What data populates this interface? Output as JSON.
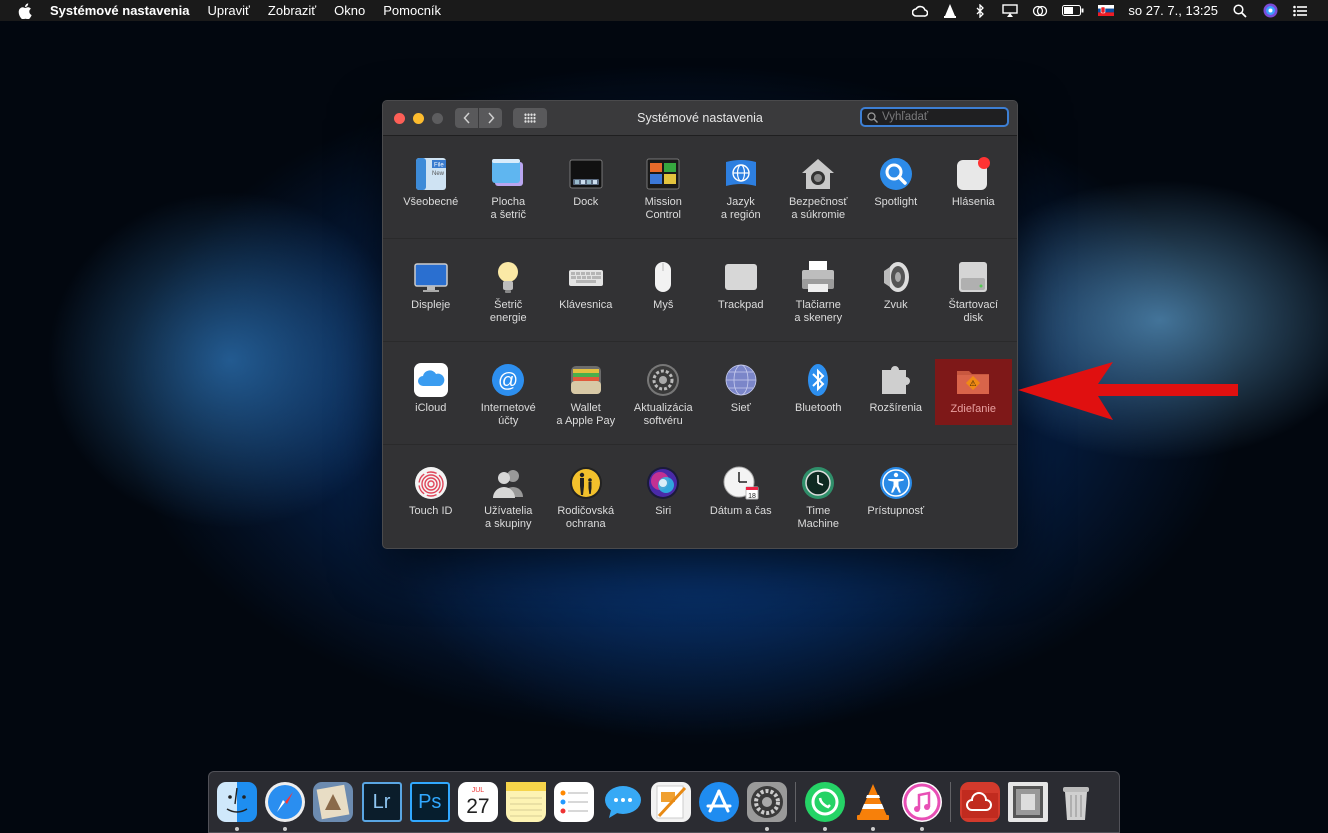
{
  "menubar": {
    "app_name": "Systémové nastavenia",
    "items": [
      "Upraviť",
      "Zobraziť",
      "Okno",
      "Pomocník"
    ],
    "clock": "so 27. 7.,  13:25",
    "status_icons": [
      "creative-cloud-icon",
      "vlc-icon",
      "bluetooth-icon",
      "airplay-icon",
      "sync-icon",
      "battery-icon",
      "slovak-flag-icon",
      "spotlight-icon",
      "siri-icon",
      "notification-center-icon"
    ]
  },
  "window": {
    "title": "Systémové nastavenia",
    "search_placeholder": "Vyhľadať",
    "rows": [
      [
        {
          "name": "general",
          "label": "Všeobecné",
          "icon": "general-icon"
        },
        {
          "name": "desktop-screensaver",
          "label": "Plocha\na šetrič",
          "icon": "desktop-icon"
        },
        {
          "name": "dock",
          "label": "Dock",
          "icon": "dock-icon"
        },
        {
          "name": "mission-control",
          "label": "Mission\nControl",
          "icon": "mission-control-icon"
        },
        {
          "name": "language-region",
          "label": "Jazyk\na región",
          "icon": "language-flag-icon"
        },
        {
          "name": "security-privacy",
          "label": "Bezpečnosť\na súkromie",
          "icon": "house-lock-icon"
        },
        {
          "name": "spotlight",
          "label": "Spotlight",
          "icon": "magnifier-icon"
        },
        {
          "name": "notifications",
          "label": "Hlásenia",
          "icon": "notifications-icon"
        }
      ],
      [
        {
          "name": "displays",
          "label": "Displeje",
          "icon": "display-icon"
        },
        {
          "name": "energy-saver",
          "label": "Šetrič\nenergie",
          "icon": "lightbulb-icon"
        },
        {
          "name": "keyboard",
          "label": "Klávesnica",
          "icon": "keyboard-icon"
        },
        {
          "name": "mouse",
          "label": "Myš",
          "icon": "mouse-icon"
        },
        {
          "name": "trackpad",
          "label": "Trackpad",
          "icon": "trackpad-icon"
        },
        {
          "name": "printers-scanners",
          "label": "Tlačiarne\na skenery",
          "icon": "printer-icon"
        },
        {
          "name": "sound",
          "label": "Zvuk",
          "icon": "speaker-icon"
        },
        {
          "name": "startup-disk",
          "label": "Štartovací\ndisk",
          "icon": "disk-icon"
        }
      ],
      [
        {
          "name": "icloud",
          "label": "iCloud",
          "icon": "icloud-icon"
        },
        {
          "name": "internet-accounts",
          "label": "Internetové\núčty",
          "icon": "at-sign-icon"
        },
        {
          "name": "wallet-apple-pay",
          "label": "Wallet\na Apple Pay",
          "icon": "wallet-icon"
        },
        {
          "name": "software-update",
          "label": "Aktualizácia\nsoftvéru",
          "icon": "gear-icon"
        },
        {
          "name": "network",
          "label": "Sieť",
          "icon": "globe-icon"
        },
        {
          "name": "bluetooth",
          "label": "Bluetooth",
          "icon": "bluetooth-icon"
        },
        {
          "name": "extensions",
          "label": "Rozšírenia",
          "icon": "puzzle-icon"
        },
        {
          "name": "sharing",
          "label": "Zdieľanie",
          "icon": "sharing-folder-icon",
          "highlighted": true
        }
      ],
      [
        {
          "name": "touch-id",
          "label": "Touch ID",
          "icon": "fingerprint-icon"
        },
        {
          "name": "users-groups",
          "label": "Užívatelia\na skupiny",
          "icon": "users-icon"
        },
        {
          "name": "parental-controls",
          "label": "Rodičovská\nochrana",
          "icon": "parental-icon"
        },
        {
          "name": "siri",
          "label": "Siri",
          "icon": "siri-icon"
        },
        {
          "name": "date-time",
          "label": "Dátum a čas",
          "icon": "clock-calendar-icon"
        },
        {
          "name": "time-machine",
          "label": "Time\nMachine",
          "icon": "time-machine-icon"
        },
        {
          "name": "accessibility",
          "label": "Prístupnosť",
          "icon": "accessibility-icon"
        }
      ]
    ]
  },
  "dock": {
    "apps": [
      {
        "name": "finder",
        "icon": "finder-icon",
        "running": true
      },
      {
        "name": "safari",
        "icon": "safari-icon",
        "running": true
      },
      {
        "name": "preview",
        "icon": "preview-icon",
        "running": false
      },
      {
        "name": "lightroom",
        "icon": "lightroom-icon",
        "text": "Lr",
        "running": false
      },
      {
        "name": "photoshop",
        "icon": "photoshop-icon",
        "text": "Ps",
        "running": false
      },
      {
        "name": "calendar",
        "icon": "calendar-icon",
        "month": "JUL",
        "day": "27",
        "running": false
      },
      {
        "name": "notes",
        "icon": "notes-icon",
        "running": false
      },
      {
        "name": "reminders",
        "icon": "reminders-icon",
        "running": false
      },
      {
        "name": "messages",
        "icon": "messages-icon",
        "running": false
      },
      {
        "name": "pages",
        "icon": "pages-icon",
        "running": false
      },
      {
        "name": "app-store",
        "icon": "app-store-icon",
        "running": false
      },
      {
        "name": "system-preferences",
        "icon": "system-preferences-icon",
        "running": true
      }
    ],
    "apps_right": [
      {
        "name": "whatsapp",
        "icon": "whatsapp-icon",
        "running": true
      },
      {
        "name": "vlc",
        "icon": "vlc-icon",
        "running": true
      },
      {
        "name": "itunes",
        "icon": "itunes-icon",
        "running": true
      }
    ],
    "stacks": [
      {
        "name": "creative-cloud-folder",
        "icon": "creative-cloud-folder-icon"
      },
      {
        "name": "downloads-stack",
        "icon": "downloads-stack-icon"
      },
      {
        "name": "trash",
        "icon": "trash-icon"
      }
    ]
  },
  "colors": {
    "highlight": "#7e1818",
    "arrow": "#e01010",
    "search_focus": "#3d7fd4"
  }
}
